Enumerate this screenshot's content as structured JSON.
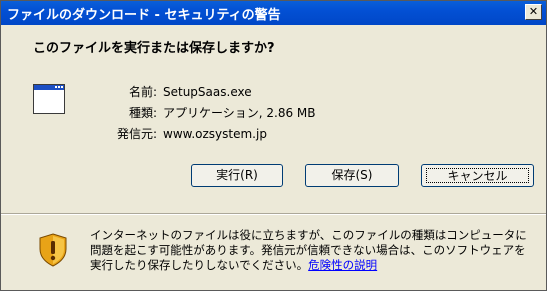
{
  "window": {
    "title": "ファイルのダウンロード - セキュリティの警告",
    "close_label": "✕"
  },
  "question": "このファイルを実行または保存しますか?",
  "file": {
    "name_label": "名前:",
    "name_value": "SetupSaas.exe",
    "type_label": "種類:",
    "type_value": "アプリケーション, 2.86 MB",
    "from_label": "発信元:",
    "from_value": "www.ozsystem.jp",
    "icon": "application-window-icon"
  },
  "buttons": {
    "run": "実行(R)",
    "save": "保存(S)",
    "cancel": "キャンセル"
  },
  "warning": {
    "icon": "security-shield-icon",
    "text": "インターネットのファイルは役に立ちますが、このファイルの種類はコンピュータに問題を起こす可能性があります。発信元が信頼できない場合は、このソフトウェアを実行したり保存したりしないでください。",
    "link": "危険性の説明"
  },
  "colors": {
    "titlebar": "#0350d4",
    "dialog_bg": "#ece9d8",
    "link": "#0000ff"
  }
}
